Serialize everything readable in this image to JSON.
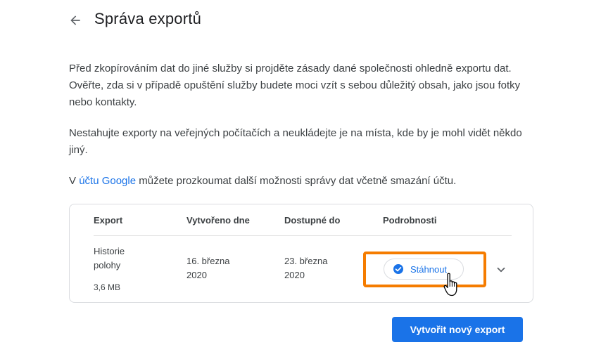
{
  "header": {
    "title": "Správa exportů",
    "back_icon": "arrow-back-icon"
  },
  "intro": {
    "p1": "Před zkopírováním dat do jiné služby si projděte zásady dané společnosti ohledně exportu dat. Ověřte, zda si v případě opuštění služby budete moci vzít s sebou důležitý obsah, jako jsou fotky nebo kontakty.",
    "p2": "Nestahujte exporty na veřejných počítačích a neukládejte je na místa, kde by je mohl vidět někdo jiný.",
    "p3_before": "V ",
    "p3_link": "účtu Google",
    "p3_after": " můžete prozkoumat další možnosti správy dat včetně smazání účtu."
  },
  "table": {
    "headers": {
      "export": "Export",
      "created": "Vytvořeno dne",
      "available": "Dostupné do",
      "details": "Podrobnosti"
    },
    "rows": [
      {
        "name": "Historie polohy",
        "size": "3,6 MB",
        "created": "16. března 2020",
        "available": "23. března 2020",
        "download_label": "Stáhnout"
      }
    ]
  },
  "actions": {
    "new_export": "Vytvořit nový export"
  },
  "colors": {
    "accent": "#1a73e8",
    "highlight": "#f57c00"
  }
}
